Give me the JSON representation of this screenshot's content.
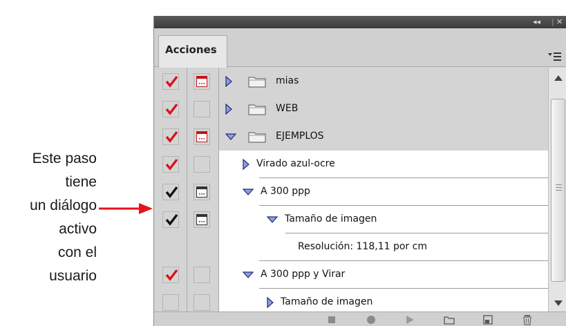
{
  "annotation": {
    "lines": [
      "Este paso",
      "tiene",
      "un diálogo",
      "activo",
      "con el",
      "usuario"
    ],
    "arrow_color": "#e8121c"
  },
  "panel": {
    "title_controls": {
      "collapse": "◂◂",
      "close": "✕"
    },
    "tab_label": "Acciones",
    "menu_icon": "panel-menu-icon"
  },
  "rows": [
    {
      "label": "mias",
      "type": "set",
      "expanded": false,
      "check": "red",
      "dialog": "red",
      "selected": true
    },
    {
      "label": "WEB",
      "type": "set",
      "expanded": false,
      "check": "red",
      "dialog": "empty",
      "selected": true
    },
    {
      "label": "EJEMPLOS",
      "type": "set",
      "expanded": true,
      "check": "red",
      "dialog": "red",
      "selected": true
    },
    {
      "label": "Virado azul-ocre",
      "type": "action",
      "expanded": false,
      "check": "red",
      "dialog": "empty",
      "selected": false
    },
    {
      "label": "A 300 ppp",
      "type": "action",
      "expanded": true,
      "check": "black",
      "dialog": "black",
      "selected": false
    },
    {
      "label": "Tamaño de imagen",
      "type": "step",
      "expanded": true,
      "check": "black",
      "dialog": "black",
      "selected": false
    },
    {
      "label": "Resolución: 118,11 por cm",
      "type": "detail",
      "expanded": null,
      "check": "none",
      "dialog": "none",
      "selected": false
    },
    {
      "label": "A 300 ppp y Virar",
      "type": "action",
      "expanded": true,
      "check": "red",
      "dialog": "empty",
      "selected": false
    },
    {
      "label": "Tamaño de imagen",
      "type": "step",
      "expanded": false,
      "check": "empty",
      "dialog": "empty",
      "selected": false
    }
  ],
  "toolbar": {
    "buttons": [
      "stop-icon",
      "record-icon",
      "play-icon",
      "new-set-icon",
      "new-action-icon",
      "delete-icon"
    ]
  },
  "colors": {
    "check_red": "#d4161c",
    "check_black": "#111111",
    "triangle_fill": "#8f9fd9",
    "triangle_stroke": "#1e2a7a",
    "selected_row": "#d4d4d4"
  }
}
